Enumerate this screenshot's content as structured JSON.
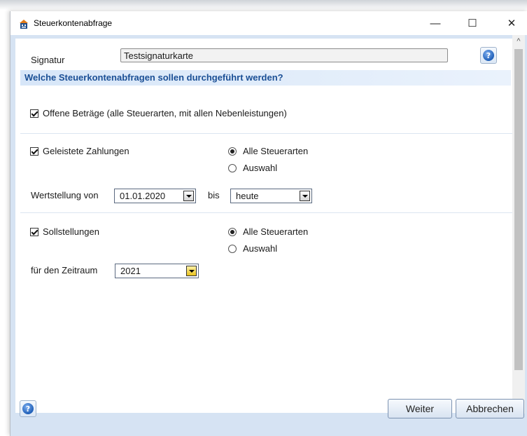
{
  "window": {
    "title": "Steuerkontenabfrage",
    "controls": {
      "minimize": "—",
      "maximize": "☐",
      "close": "✕"
    }
  },
  "signatur": {
    "label": "Signatur",
    "value": "Testsignaturkarte"
  },
  "section_header": "Welche Steuerkontenabfragen sollen durchgeführt werden?",
  "offene": {
    "label": "Offene Beträge (alle Steuerarten, mit allen Nebenleistungen)",
    "checked": true
  },
  "zahlungen": {
    "label": "Geleistete Zahlungen",
    "checked": true,
    "radio_all": "Alle Steuerarten",
    "radio_select": "Auswahl",
    "selected": "Alle Steuerarten"
  },
  "wertstellung": {
    "label": "Wertstellung von",
    "from": "01.01.2020",
    "bis_label": "bis",
    "to": "heute"
  },
  "soll": {
    "label": "Sollstellungen",
    "checked": true,
    "radio_all": "Alle Steuerarten",
    "radio_select": "Auswahl",
    "selected": "Alle Steuerarten"
  },
  "zeitraum": {
    "label": "für den Zeitraum",
    "value": "2021"
  },
  "buttons": {
    "weiter": "Weiter",
    "abbrechen": "Abbrechen"
  },
  "scroll": {
    "up": "^",
    "down": "v"
  },
  "help_glyph": "?",
  "colors": {
    "header_text": "#1a4f95",
    "accent_bg": "#d6e3f3"
  }
}
